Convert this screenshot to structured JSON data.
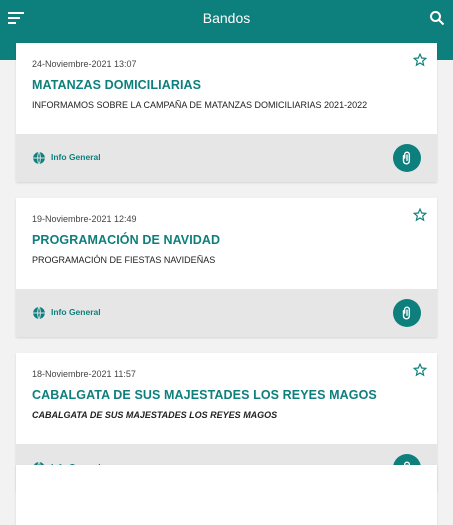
{
  "appbar": {
    "title": "Bandos",
    "menu_icon": "menu-icon",
    "search_icon": "search-icon"
  },
  "colors": {
    "primary": "#0d7f7c",
    "footer_bg": "#e6e6e6",
    "page_bg": "#f2f2f2"
  },
  "cards": [
    {
      "date": "24-Noviembre-2021 13:07",
      "title": "MATANZAS DOMICILIARIAS",
      "description": "INFORMAMOS SOBRE LA CAMPAÑA DE MATANZAS DOMICILIARIAS 2021-2022",
      "category": "Info General"
    },
    {
      "date": "19-Noviembre-2021 12:49",
      "title": "PROGRAMACIÓN DE NAVIDAD",
      "description": "PROGRAMACIÓN DE FIESTAS NAVIDEÑAS",
      "category": "Info General"
    },
    {
      "date": "18-Noviembre-2021 11:57",
      "title": "CABALGATA DE  SUS MAJESTADES LOS REYES MAGOS",
      "description": "CABALGATA DE  SUS MAJESTADES LOS REYES MAGOS",
      "category": "Info General"
    }
  ]
}
